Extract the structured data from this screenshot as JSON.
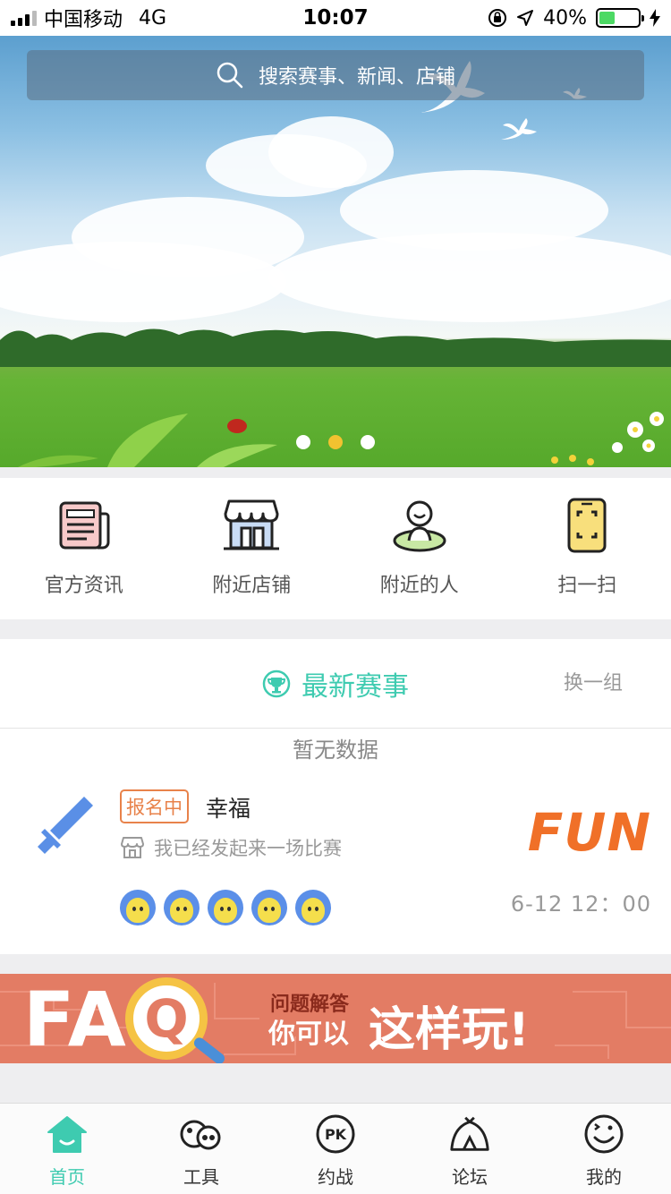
{
  "status_bar": {
    "carrier": "中国移动",
    "network": "4G",
    "time": "10:07",
    "battery_percent": "40%",
    "battery_level": 0.4
  },
  "search": {
    "placeholder": "搜索赛事、新闻、店铺"
  },
  "banner": {
    "slide_count": 3,
    "active_slide": 1
  },
  "quick_nav": [
    {
      "label": "官方资讯",
      "icon": "news-icon"
    },
    {
      "label": "附近店铺",
      "icon": "store-icon"
    },
    {
      "label": "附近的人",
      "icon": "person-icon"
    },
    {
      "label": "扫一扫",
      "icon": "scan-icon"
    }
  ],
  "match_section": {
    "title": "最新赛事",
    "switch_label": "换一组",
    "empty_text": "暂无数据",
    "event": {
      "status_tag": "报名中",
      "name": "幸福",
      "description": "我已经发起来一场比赛",
      "logo_text": "FUN",
      "time": "6-12 12：00",
      "participant_count": 5
    }
  },
  "faq_banner": {
    "big_text": "FA",
    "q_letter": "Q",
    "sub_text": "问题解答",
    "main_text_a": "你可以",
    "main_text_b": "这样玩!"
  },
  "tab_bar": [
    {
      "label": "首页",
      "icon": "home-icon",
      "active": true
    },
    {
      "label": "工具",
      "icon": "tools-icon",
      "active": false
    },
    {
      "label": "约战",
      "icon": "pk-icon",
      "active": false
    },
    {
      "label": "论坛",
      "icon": "forum-icon",
      "active": false
    },
    {
      "label": "我的",
      "icon": "profile-icon",
      "active": false
    }
  ],
  "colors": {
    "accent": "#3ecbb0",
    "tag": "#e8824a",
    "faq_bg": "#e37c64",
    "dot_active": "#f2c230"
  }
}
